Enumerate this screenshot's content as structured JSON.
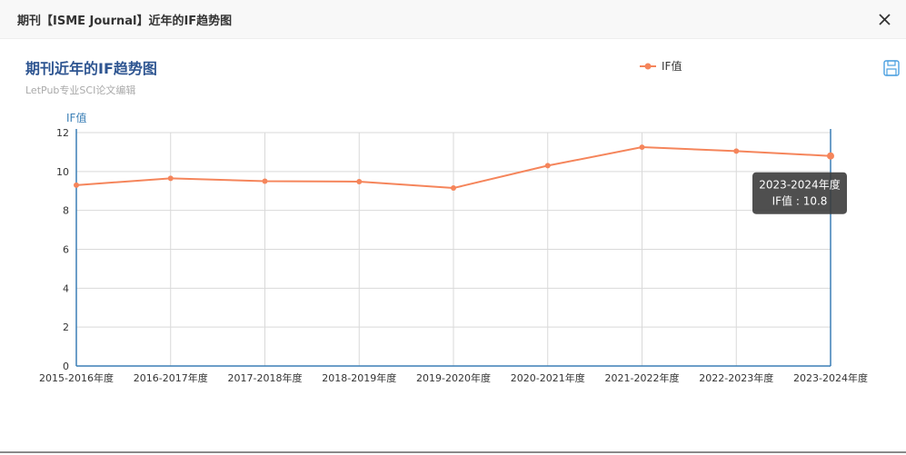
{
  "dialog": {
    "title": "期刊【ISME Journal】近年的IF趋势图"
  },
  "colors": {
    "series": "#f5855b",
    "axis": "#3b7fb6",
    "title": "#2e5591",
    "grid": "#d9d9d9",
    "tooltip_bg": "#3c3c3c"
  },
  "chart_data": {
    "type": "line",
    "title": "期刊近年的IF趋势图",
    "subtitle": "LetPub专业SCI论文编辑",
    "ylabel": "IF值",
    "xlabel": "",
    "categories": [
      "2015-2016年度",
      "2016-2017年度",
      "2017-2018年度",
      "2018-2019年度",
      "2019-2020年度",
      "2020-2021年度",
      "2021-2022年度",
      "2022-2023年度",
      "2023-2024年度"
    ],
    "series": [
      {
        "name": "IF值",
        "values": [
          9.3,
          9.65,
          9.5,
          9.48,
          9.15,
          10.3,
          11.25,
          11.05,
          10.8
        ]
      }
    ],
    "yticks": [
      0,
      2,
      4,
      6,
      8,
      10,
      12
    ],
    "ylim": [
      0,
      12
    ],
    "grid": true,
    "legend": "top-center",
    "tooltip": {
      "index": 8,
      "title": "2023-2024年度",
      "text": "IF值 : 10.8"
    }
  }
}
